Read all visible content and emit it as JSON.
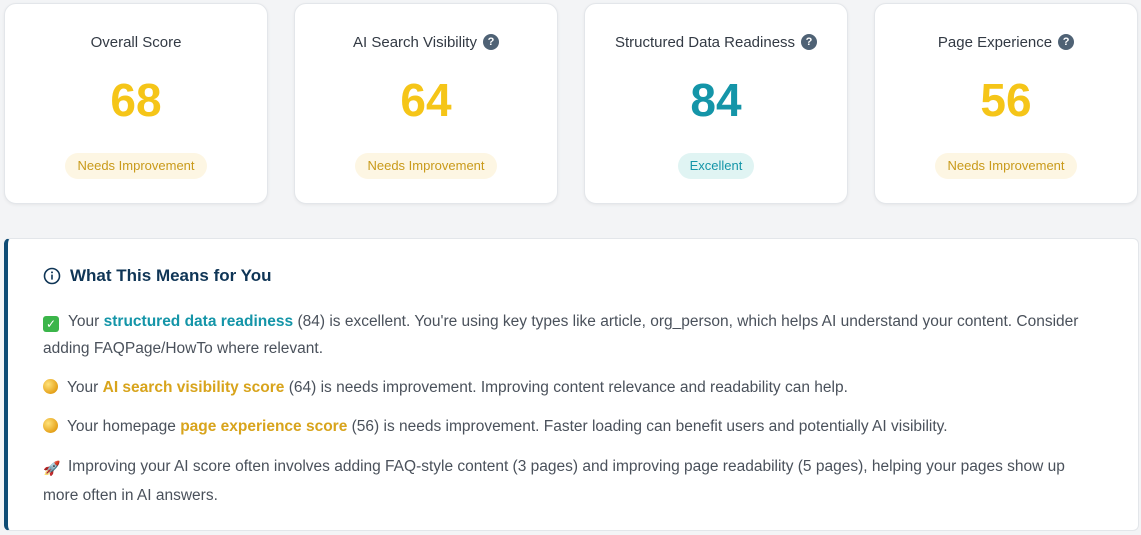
{
  "cards": [
    {
      "title": "Overall Score",
      "has_help": false,
      "score": "68",
      "score_color": "#f5c518",
      "badge": "Needs Improvement",
      "badge_bg": "#fdf6e3",
      "badge_fg": "#c99a1a"
    },
    {
      "title": "AI Search Visibility",
      "has_help": true,
      "score": "64",
      "score_color": "#f5c518",
      "badge": "Needs Improvement",
      "badge_bg": "#fdf6e3",
      "badge_fg": "#c99a1a"
    },
    {
      "title": "Structured Data Readiness",
      "has_help": true,
      "score": "84",
      "score_color": "#1495a8",
      "badge": "Excellent",
      "badge_bg": "#e0f4f3",
      "badge_fg": "#1495a8"
    },
    {
      "title": "Page Experience",
      "has_help": true,
      "score": "56",
      "score_color": "#f5c518",
      "badge": "Needs Improvement",
      "badge_bg": "#fdf6e3",
      "badge_fg": "#c99a1a"
    }
  ],
  "help_icon": "question-mark-icon",
  "panel": {
    "heading": "What This Means for You",
    "heading_icon": "info-circle-icon",
    "p1": {
      "prefix": "Your ",
      "highlight": "structured data readiness",
      "suffix": " (84) is excellent. You're using key types like article, org_person, which helps AI understand your content. Consider adding FAQPage/HowTo where relevant.",
      "icon": "check-mark-icon"
    },
    "p2": {
      "prefix": "Your ",
      "highlight": "AI search visibility score",
      "suffix": " (64) is needs improvement. Improving content relevance and readability can help.",
      "icon": "yellow-circle-icon"
    },
    "p3": {
      "prefix": "Your homepage ",
      "highlight": "page experience score",
      "suffix": " (56) is needs improvement. Faster loading can benefit users and potentially AI visibility.",
      "icon": "yellow-circle-icon"
    },
    "p4": {
      "text": "Improving your AI score often involves adding FAQ-style content (3 pages) and improving page readability (5 pages), helping your pages show up more often in AI answers.",
      "icon": "rocket-icon"
    }
  },
  "colors": {
    "teal": "#1495a8",
    "amber": "#d8a41c",
    "navy": "#0f3556",
    "accent_border": "#0f4c75"
  }
}
